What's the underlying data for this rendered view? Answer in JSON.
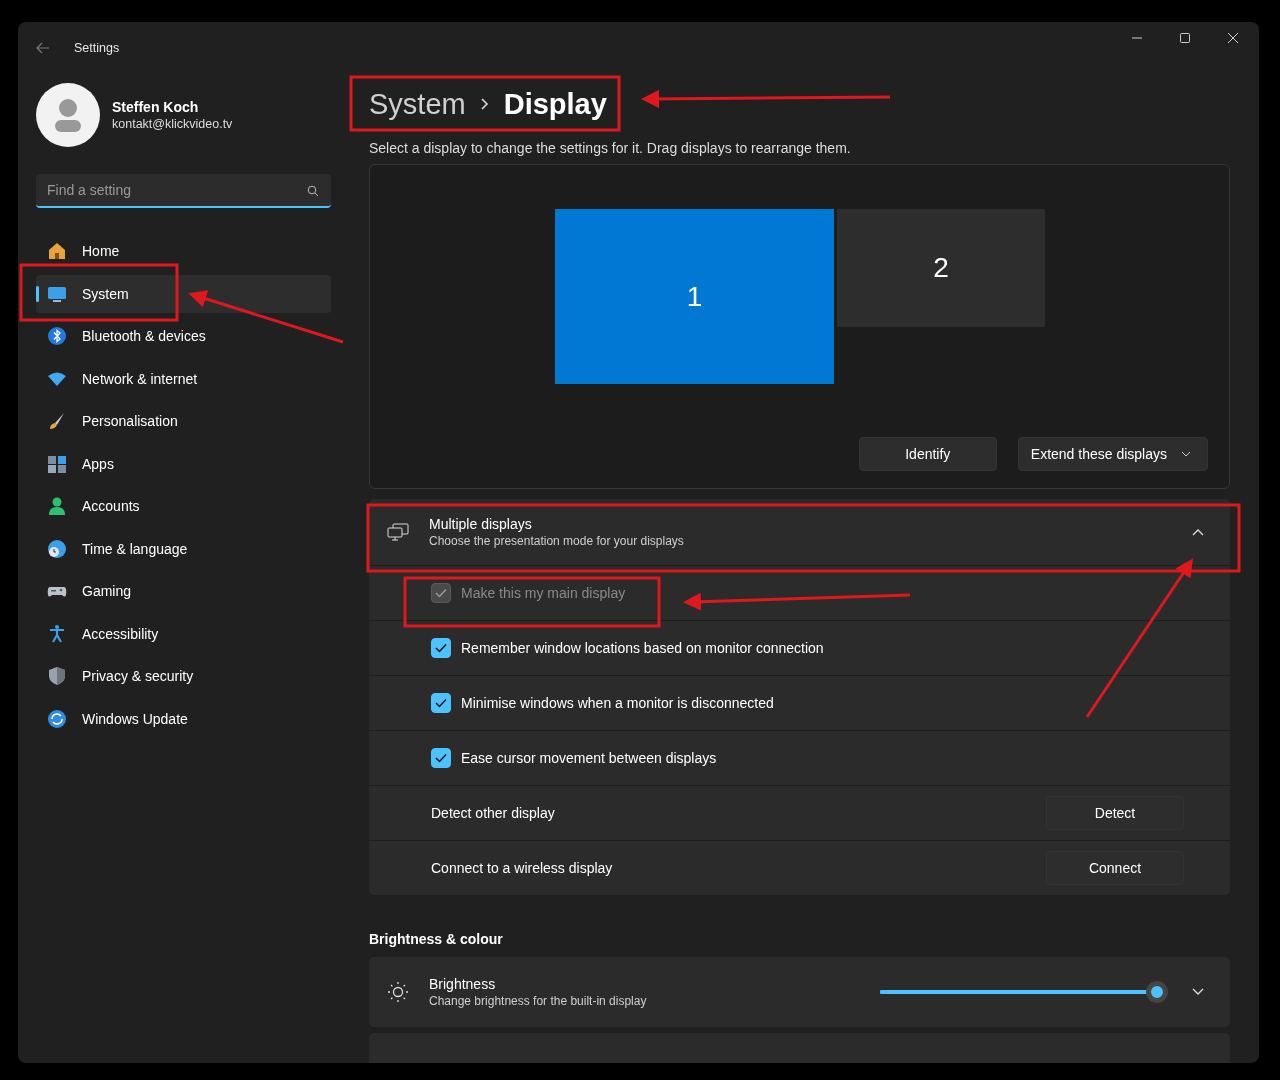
{
  "window": {
    "title": "Settings"
  },
  "user": {
    "name": "Steffen Koch",
    "email": "kontakt@klickvideo.tv"
  },
  "search": {
    "placeholder": "Find a setting"
  },
  "nav": [
    {
      "label": "Home",
      "selected": false
    },
    {
      "label": "System",
      "selected": true
    },
    {
      "label": "Bluetooth & devices",
      "selected": false
    },
    {
      "label": "Network & internet",
      "selected": false
    },
    {
      "label": "Personalisation",
      "selected": false
    },
    {
      "label": "Apps",
      "selected": false
    },
    {
      "label": "Accounts",
      "selected": false
    },
    {
      "label": "Time & language",
      "selected": false
    },
    {
      "label": "Gaming",
      "selected": false
    },
    {
      "label": "Accessibility",
      "selected": false
    },
    {
      "label": "Privacy & security",
      "selected": false
    },
    {
      "label": "Windows Update",
      "selected": false
    }
  ],
  "breadcrumb": {
    "parent": "System",
    "current": "Display"
  },
  "intro": "Select a display to change the settings for it. Drag displays to rearrange them.",
  "displays": [
    {
      "label": "1",
      "selected": true
    },
    {
      "label": "2",
      "selected": false
    }
  ],
  "identify_button": "Identify",
  "mode_dropdown": {
    "value": "Extend these displays"
  },
  "multiple_displays": {
    "title": "Multiple displays",
    "subtitle": "Choose the presentation mode for your displays",
    "expanded": true,
    "options": [
      {
        "label": "Make this my main display",
        "checked": true,
        "disabled": true
      },
      {
        "label": "Remember window locations based on monitor connection",
        "checked": true,
        "disabled": false
      },
      {
        "label": "Minimise windows when a monitor is disconnected",
        "checked": true,
        "disabled": false
      },
      {
        "label": "Ease cursor movement between displays",
        "checked": true,
        "disabled": false
      }
    ],
    "actions": [
      {
        "label": "Detect other display",
        "button": "Detect"
      },
      {
        "label": "Connect to a wireless display",
        "button": "Connect"
      }
    ]
  },
  "brightness_section": {
    "heading": "Brightness & colour",
    "title": "Brightness",
    "subtitle": "Change brightness for the built-in display",
    "level": 0.97,
    "expanded": false
  }
}
